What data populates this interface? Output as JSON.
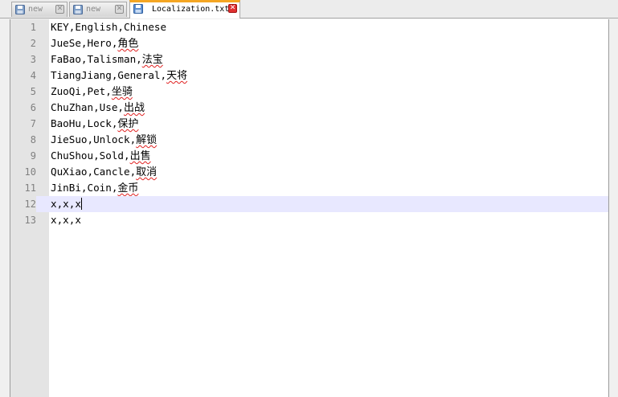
{
  "tabs": [
    {
      "label": "new",
      "active": false
    },
    {
      "label": "new",
      "active": false
    },
    {
      "label": "Localization.txt",
      "active": true
    }
  ],
  "editor": {
    "lines": [
      {
        "num": "1",
        "prefix": "KEY,English,",
        "zh": "Chinese",
        "spell": false
      },
      {
        "num": "2",
        "prefix": "JueSe,Hero,",
        "zh": "角色",
        "spell": true
      },
      {
        "num": "3",
        "prefix": "FaBao,Talisman,",
        "zh": "法宝",
        "spell": true
      },
      {
        "num": "4",
        "prefix": "TiangJiang,General,",
        "zh": "天将",
        "spell": true
      },
      {
        "num": "5",
        "prefix": "ZuoQi,Pet,",
        "zh": "坐骑",
        "spell": true
      },
      {
        "num": "6",
        "prefix": "ChuZhan,Use,",
        "zh": "出战",
        "spell": true
      },
      {
        "num": "7",
        "prefix": "BaoHu,Lock,",
        "zh": "保护",
        "spell": true
      },
      {
        "num": "8",
        "prefix": "JieSuo,Unlock,",
        "zh": "解锁",
        "spell": true
      },
      {
        "num": "9",
        "prefix": "ChuShou,Sold,",
        "zh": "出售",
        "spell": true
      },
      {
        "num": "10",
        "prefix": "QuXiao,Cancle,",
        "zh": "取消",
        "spell": true
      },
      {
        "num": "11",
        "prefix": "JinBi,Coin,",
        "zh": "金币",
        "spell": true
      },
      {
        "num": "12",
        "prefix": "x,x,x",
        "zh": "",
        "spell": false,
        "current": true
      },
      {
        "num": "13",
        "prefix": "x,x,x",
        "zh": "",
        "spell": false
      }
    ]
  },
  "icons": {
    "save": "save-icon",
    "close": "close-icon"
  },
  "colors": {
    "active_tab_accent": "#f5a623",
    "current_line": "#e8e8ff",
    "gutter": "#e4e4e4",
    "close_active": "#e03030"
  }
}
